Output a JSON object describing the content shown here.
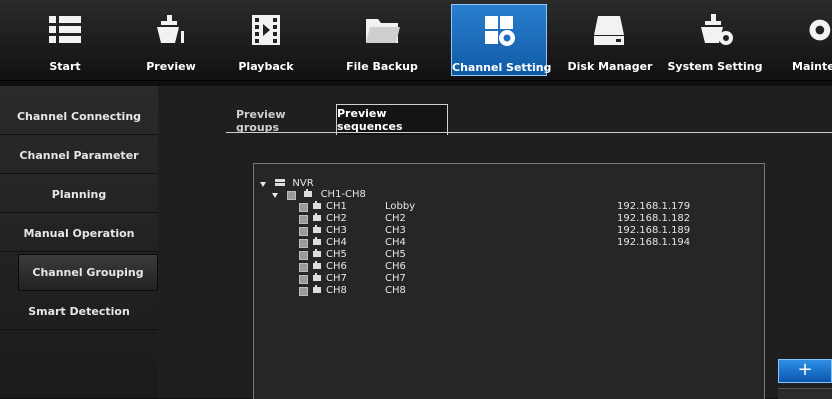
{
  "topnav": {
    "tabs": [
      {
        "label": "Start",
        "icon": "menu-list-icon"
      },
      {
        "label": "Preview",
        "icon": "camera-icon"
      },
      {
        "label": "Playback",
        "icon": "film-play-icon"
      },
      {
        "label": "File Backup",
        "icon": "folder-icon"
      },
      {
        "label": "Channel Setting",
        "icon": "channel-setting-icon",
        "active": true
      },
      {
        "label": "Disk Manager",
        "icon": "disk-icon"
      },
      {
        "label": "System Setting",
        "icon": "system-setting-icon"
      },
      {
        "label": "Maintenance",
        "icon": "gear-icon"
      }
    ]
  },
  "sidebar": {
    "items": [
      {
        "label": "Channel Connecting"
      },
      {
        "label": "Channel Parameter"
      },
      {
        "label": "Planning"
      },
      {
        "label": "Manual Operation"
      },
      {
        "label": "Channel Grouping",
        "active": true
      },
      {
        "label": "Smart Detection"
      }
    ]
  },
  "subtabs": [
    {
      "label": "Preview groups"
    },
    {
      "label": "Preview sequences",
      "active": true
    }
  ],
  "tree": {
    "root": "NVR",
    "group": "CH1-CH8",
    "channels": [
      {
        "id": "CH1",
        "name": "Lobby",
        "ip": "192.168.1.179"
      },
      {
        "id": "CH2",
        "name": "CH2",
        "ip": "192.168.1.182"
      },
      {
        "id": "CH3",
        "name": "CH3",
        "ip": "192.168.1.189"
      },
      {
        "id": "CH4",
        "name": "CH4",
        "ip": "192.168.1.194"
      },
      {
        "id": "CH5",
        "name": "CH5",
        "ip": ""
      },
      {
        "id": "CH6",
        "name": "CH6",
        "ip": ""
      },
      {
        "id": "CH7",
        "name": "CH7",
        "ip": ""
      },
      {
        "id": "CH8",
        "name": "CH8",
        "ip": ""
      }
    ]
  },
  "actions": {
    "add_label": "+"
  },
  "colors": {
    "accent": "#1f6fc1",
    "panel": "#1f1f1f",
    "text": "#e6e6e6"
  }
}
